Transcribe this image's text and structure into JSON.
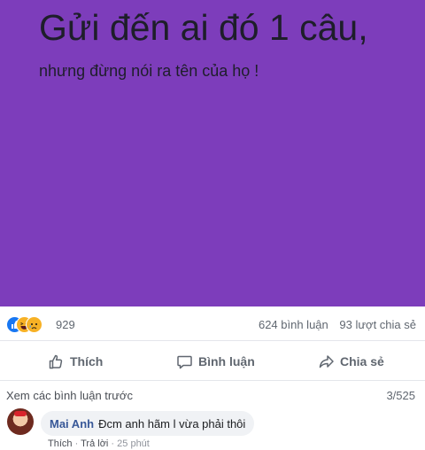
{
  "post": {
    "headline": "Gửi đến ai đó 1 câu,",
    "subline": "nhưng đừng nói ra tên của họ !",
    "background_color": "#7d3dbb",
    "reactions": [
      "like-icon",
      "haha-icon",
      "sad-icon"
    ],
    "reaction_count": "929",
    "comment_count": "624 bình luận",
    "share_count": "93 lượt chia sẻ"
  },
  "actions": {
    "like": "Thích",
    "comment": "Bình luận",
    "share": "Chia sẻ"
  },
  "comments": {
    "view_previous": "Xem các bình luận trước",
    "pager": "3/525",
    "items": [
      {
        "author": "Mai Anh",
        "text": "Đcm anh hãm l vừa phải thôi",
        "like": "Thích",
        "reply": "Trả lời",
        "time": "25 phút"
      }
    ]
  }
}
